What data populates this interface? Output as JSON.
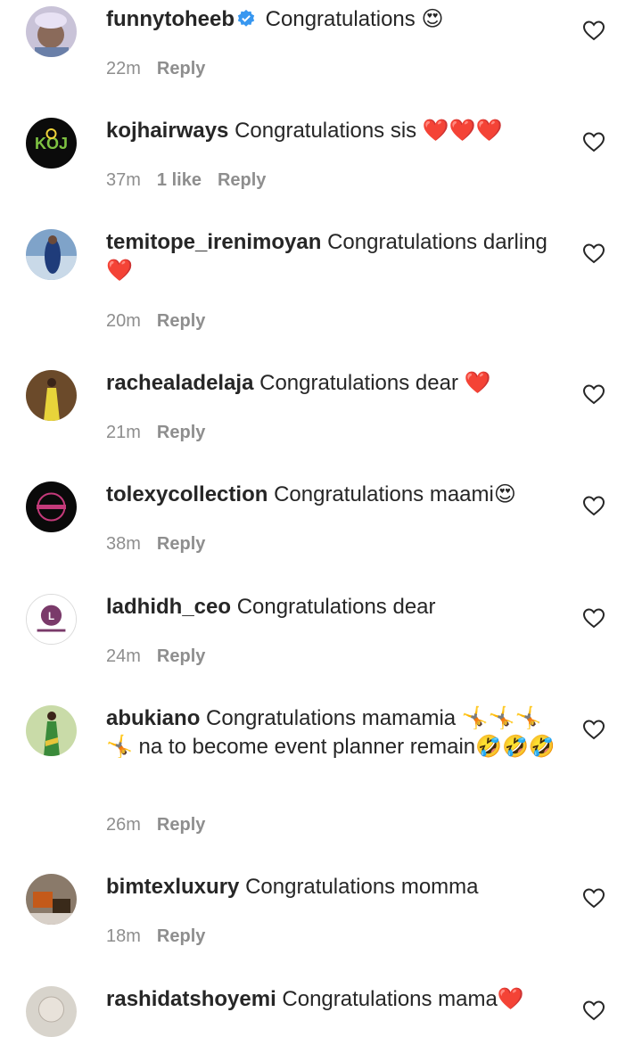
{
  "comments": [
    {
      "username": "funnytoheeb",
      "verified": true,
      "text": "Congratulations 😍",
      "time": "22m",
      "likes": "",
      "reply": "Reply"
    },
    {
      "username": "kojhairways",
      "verified": false,
      "text": "Congratulations sis ❤️❤️❤️",
      "time": "37m",
      "likes": "1 like",
      "reply": "Reply"
    },
    {
      "username": "temitope_irenimoyan",
      "verified": false,
      "text": "Congratulations darling ❤️",
      "time": "20m",
      "likes": "",
      "reply": "Reply"
    },
    {
      "username": "rachealadelaja",
      "verified": false,
      "text": "Congratulations dear ❤️",
      "time": "21m",
      "likes": "",
      "reply": "Reply"
    },
    {
      "username": "tolexycollection",
      "verified": false,
      "text": "Congratulations maami😍",
      "time": "38m",
      "likes": "",
      "reply": "Reply"
    },
    {
      "username": "ladhidh_ceo",
      "verified": false,
      "text": "Congratulations dear",
      "time": "24m",
      "likes": "",
      "reply": "Reply"
    },
    {
      "username": "abukiano",
      "verified": false,
      "text": "Congratulations mamamia 🤸🤸🤸🤸 na to become event planner remain🤣🤣🤣",
      "time": "26m",
      "likes": "",
      "reply": "Reply"
    },
    {
      "username": "bimtexluxury",
      "verified": false,
      "text": "Congratulations momma",
      "time": "18m",
      "likes": "",
      "reply": "Reply"
    },
    {
      "username": "rashidatshoyemi",
      "verified": false,
      "text": "Congratulations mama❤️",
      "time": "",
      "likes": "",
      "reply": ""
    }
  ],
  "colors": {
    "text": "#262626",
    "meta": "#8e8e8e",
    "verified": "#3897f0"
  }
}
